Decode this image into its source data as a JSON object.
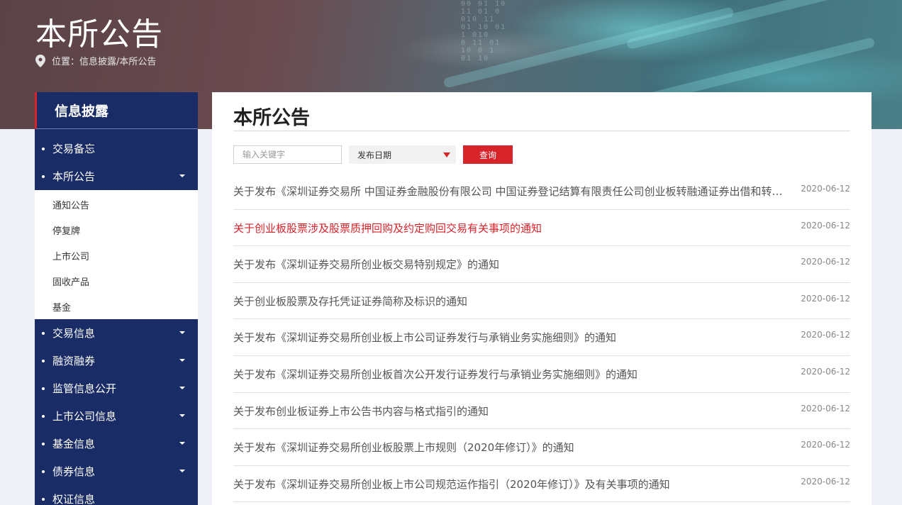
{
  "header": {
    "title": "本所公告",
    "location_text": "位置：信息披露/本所公告"
  },
  "sidebar": {
    "heading": "信息披露",
    "items": [
      {
        "label": "交易备忘",
        "has_caret": false
      },
      {
        "label": "本所公告",
        "has_caret": true,
        "expanded": true,
        "children": [
          "通知公告",
          "停复牌",
          "上市公司",
          "固收产品",
          "基金"
        ]
      },
      {
        "label": "交易信息",
        "has_caret": true
      },
      {
        "label": "融资融券",
        "has_caret": true
      },
      {
        "label": "监管信息公开",
        "has_caret": true
      },
      {
        "label": "上市公司信息",
        "has_caret": true
      },
      {
        "label": "基金信息",
        "has_caret": true
      },
      {
        "label": "债券信息",
        "has_caret": true
      },
      {
        "label": "权证信息",
        "has_caret": false
      }
    ]
  },
  "main": {
    "title": "本所公告",
    "search": {
      "placeholder": "输入关键字"
    },
    "date_select": {
      "value": "发布日期"
    },
    "query_label": "查询",
    "notices": [
      {
        "title": "关于发布《深圳证券交易所 中国证券金融股份有限公司 中国证券登记结算有限责任公司创业板转融通证券出借和转融券业务实施细则》的通知",
        "date": "2020-06-12"
      },
      {
        "title": "关于创业板股票涉及股票质押回购及约定购回交易有关事项的通知",
        "date": "2020-06-12",
        "active": true
      },
      {
        "title": "关于发布《深圳证券交易所创业板交易特别规定》的通知",
        "date": "2020-06-12"
      },
      {
        "title": "关于创业板股票及存托凭证证券简称及标识的通知",
        "date": "2020-06-12"
      },
      {
        "title": "关于发布《深圳证券交易所创业板上市公司证券发行与承销业务实施细则》的通知",
        "date": "2020-06-12"
      },
      {
        "title": "关于发布《深圳证券交易所创业板首次公开发行证券发行与承销业务实施细则》的通知",
        "date": "2020-06-12"
      },
      {
        "title": "关于发布创业板证券上市公告书内容与格式指引的通知",
        "date": "2020-06-12"
      },
      {
        "title": "关于发布《深圳证券交易所创业板股票上市规则（2020年修订）》的通知",
        "date": "2020-06-12"
      },
      {
        "title": "关于发布《深圳证券交易所创业板上市公司规范运作指引（2020年修订）》及有关事项的通知",
        "date": "2020-06-12"
      }
    ]
  },
  "colors": {
    "accent_red": "#d7232a",
    "sidebar_navy": "#1a2c66"
  },
  "icons": {
    "location": "map-pin-icon",
    "caret": "caret-down-icon",
    "select_arrow": "triangle-down-icon"
  }
}
